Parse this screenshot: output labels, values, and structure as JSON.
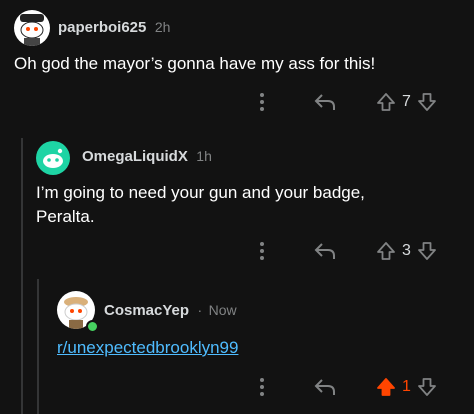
{
  "comments": [
    {
      "username": "paperboi625",
      "time": "2h",
      "text": "Oh god the mayor’s gonna have my ass for this!",
      "votes": "7",
      "avatar_bg": "#ffffff"
    },
    {
      "username": "OmegaLiquidX",
      "time": "1h",
      "text_line1": "I’m going to need your gun and your badge,",
      "text_line2": "Peralta.",
      "votes": "3",
      "avatar_bg": "#1ed4a4"
    },
    {
      "username": "CosmacYep",
      "separator": "·",
      "time": "Now",
      "link": "r/unexpectedbrooklyn99",
      "votes": "1",
      "avatar_bg": "#ffffff",
      "upvoted": true
    }
  ],
  "colors": {
    "background": "#121212",
    "upvote_active": "#ff4500",
    "link": "#4fbcff",
    "muted": "#818384"
  },
  "icons": [
    "more-options-icon",
    "reply-icon",
    "upvote-icon",
    "downvote-icon"
  ]
}
